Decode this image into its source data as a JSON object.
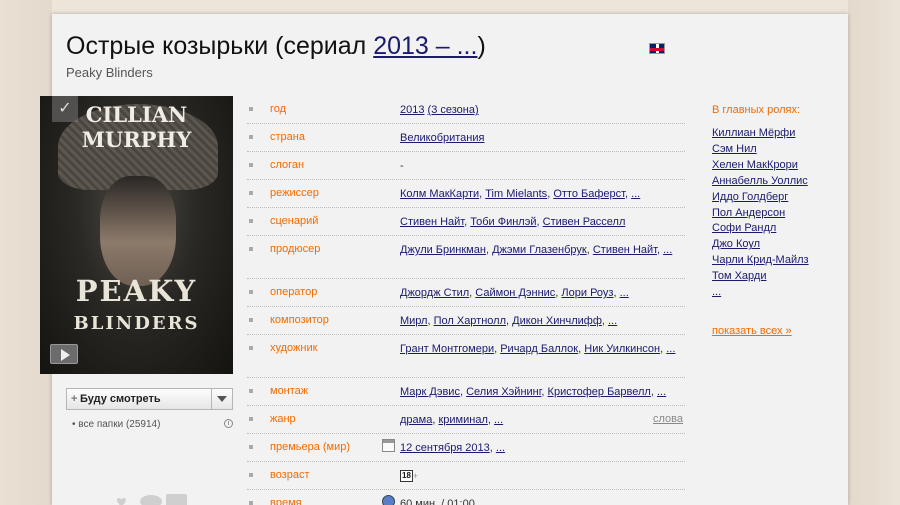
{
  "header": {
    "title_prefix": "Острые козырьки (сериал ",
    "title_years": "2013 – ...",
    "title_suffix": ")",
    "original_title": "Peaky Blinders"
  },
  "poster": {
    "actor_text": "CILLIAN MURPHY",
    "show_line1": "PEAKY",
    "show_line2": "BLINDERS",
    "check_icon": "✓"
  },
  "watch": {
    "label": "Буду смотреть",
    "folders": "все папки (25914)",
    "info_icon": "i"
  },
  "info_rows": [
    {
      "label": "год",
      "values": [
        "2013",
        "(3 сезона)"
      ]
    },
    {
      "label": "страна",
      "values": [
        "Великобритания"
      ]
    },
    {
      "label": "слоган",
      "values": [
        "-"
      ]
    },
    {
      "label": "режиссер",
      "values": [
        "Колм МакКарти",
        "Tim Mielants",
        "Отто Баферст",
        "..."
      ]
    },
    {
      "label": "сценарий",
      "values": [
        "Стивен Найт",
        "Тоби Финлэй",
        "Стивен Расселл"
      ]
    },
    {
      "label": "продюсер",
      "values": [
        "Джули Бринкман",
        "Джэми Глазенбрук",
        "Стивен Найт",
        "..."
      ]
    },
    {
      "label": "оператор",
      "values": [
        "Джордж Стил",
        "Саймон Дэннис",
        "Лори Роуз",
        "..."
      ]
    },
    {
      "label": "композитор",
      "values": [
        "Мирл",
        "Пол Хартнолл",
        "Дикон Хинчлифф",
        "..."
      ]
    },
    {
      "label": "художник",
      "values": [
        "Грант Монтгомери",
        "Ричард Баллок",
        "Ник Уилкинсон",
        "..."
      ]
    },
    {
      "label": "монтаж",
      "values": [
        "Марк Дэвис",
        "Селия Хэйнинг",
        "Кристофер Барвелл",
        "..."
      ]
    },
    {
      "label": "жанр",
      "values": [
        "драма",
        "криминал",
        "..."
      ],
      "extra": "слова"
    },
    {
      "label": "премьера (мир)",
      "values": [
        "12 сентября 2013",
        "..."
      ]
    },
    {
      "label": "возраст",
      "badge": "18",
      "badge_plus": "+"
    },
    {
      "label": "время",
      "text": "60 мин. / 01:00"
    }
  ],
  "roles": {
    "heading": "В главных ролях:",
    "actors": [
      "Киллиан Мёрфи",
      "Сэм Нил",
      "Хелен МакКрори",
      "Аннабелль Уоллис",
      "Иддо Голдберг",
      "Пол Андерсон",
      "Софи Рандл",
      "Джо Коул",
      "Чарли Крид-Майлз",
      "Том Харди",
      "..."
    ],
    "show_all": "показать всех",
    "show_all_arrow": "»"
  },
  "colors": {
    "accent_orange": "#f26b00",
    "link_blue": "#1a1a6e",
    "page_bg": "#f2f2f2",
    "outer_bg": "#ede5d9"
  },
  "icons": [
    "check-icon",
    "play-icon",
    "plus-icon",
    "dropdown-arrow-icon",
    "info-icon",
    "calendar-icon",
    "clock-icon",
    "heart-icon",
    "eye-icon",
    "list-icon",
    "uk-flag-icon"
  ]
}
